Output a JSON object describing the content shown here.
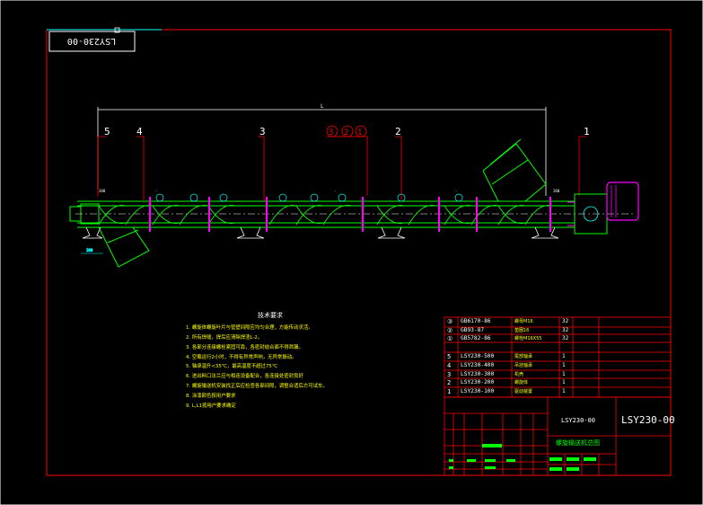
{
  "drawing_number": "LSY230-00",
  "drawing_number_rotated": "LSY230-00",
  "dimension_overall": "L",
  "balloons": [
    "5",
    "4",
    "3",
    "3",
    "2",
    "1",
    "2",
    "1"
  ],
  "technical_notes": {
    "title": "技术要求",
    "items": [
      "1. 螺旋体螺旋叶片与管壁间隙应均匀合理，方能传动灵活。",
      "2. 所有焊缝，焊后应清除焊渣L-2。",
      "3. 各部分连接螺栓紧固可靠，各密封结合面不得泄漏。",
      "4. 空载运行2小时，不得有异常声响，无异常振动。",
      "5. 轴承温升<35℃，最高温度不超过75℃",
      "6. 进出料口法兰应与相连设备配合，各连接处密封良好",
      "7. 螺旋输送机安装找正后应检查各部间隙，调整合适后方可试车。",
      "8. 涂漆颜色按用户要求",
      "9. L,L1按用户要求确定"
    ]
  },
  "parts_list": [
    {
      "no": "③",
      "code": "GB6170-86",
      "name": "螺母M16",
      "qty": "32"
    },
    {
      "no": "②",
      "code": "GB93-87",
      "name": "垫圈16",
      "qty": "32"
    },
    {
      "no": "①",
      "code": "GB5782-86",
      "name": "螺栓M16X55",
      "qty": "32"
    },
    {
      "no": "5",
      "code": "LSY230-500",
      "name": "尾部轴承",
      "qty": "1"
    },
    {
      "no": "4",
      "code": "LSY230-400",
      "name": "吊挂轴承",
      "qty": "1"
    },
    {
      "no": "3",
      "code": "LSY230-300",
      "name": "机壳",
      "qty": "1"
    },
    {
      "no": "2",
      "code": "LSY230-200",
      "name": "螺旋体",
      "qty": "1"
    },
    {
      "no": "1",
      "code": "LSY230-100",
      "name": "驱动装置",
      "qty": "1"
    }
  ],
  "title_block": {
    "drawing_code": "LSY230-00",
    "drawing_code_large": "LSY230-00",
    "drawing_name": "螺旋输送机总图"
  },
  "colors": {
    "border": "#ff0000",
    "machine": "#00ff00",
    "highlight": "#ff00ff",
    "text": "#ffff00",
    "outline": "#ffffff",
    "accent": "#00ffff"
  }
}
